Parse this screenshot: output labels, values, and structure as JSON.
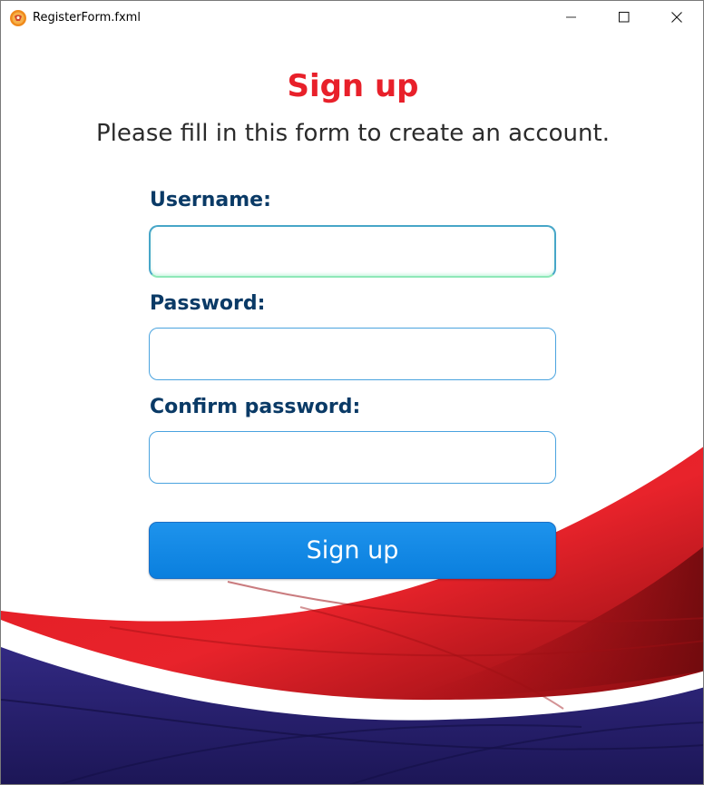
{
  "window": {
    "title": "RegisterForm.fxml",
    "app_icon": "app-logo-icon",
    "controls": {
      "minimize_icon": "minimize-icon",
      "maximize_icon": "maximize-icon",
      "close_icon": "close-icon"
    }
  },
  "form": {
    "heading": "Sign up",
    "subheading": "Please fill in this form to create an account.",
    "fields": [
      {
        "label": "Username:",
        "value": "",
        "placeholder": ""
      },
      {
        "label": "Password:",
        "value": "",
        "placeholder": ""
      },
      {
        "label": "Confirm password:",
        "value": "",
        "placeholder": ""
      }
    ],
    "submit_label": "Sign up"
  },
  "colors": {
    "heading": "#e8202a",
    "label": "#0a3a66",
    "button": "#0a7fde",
    "wave_red": "#e51e25",
    "wave_navy": "#2b2270"
  }
}
